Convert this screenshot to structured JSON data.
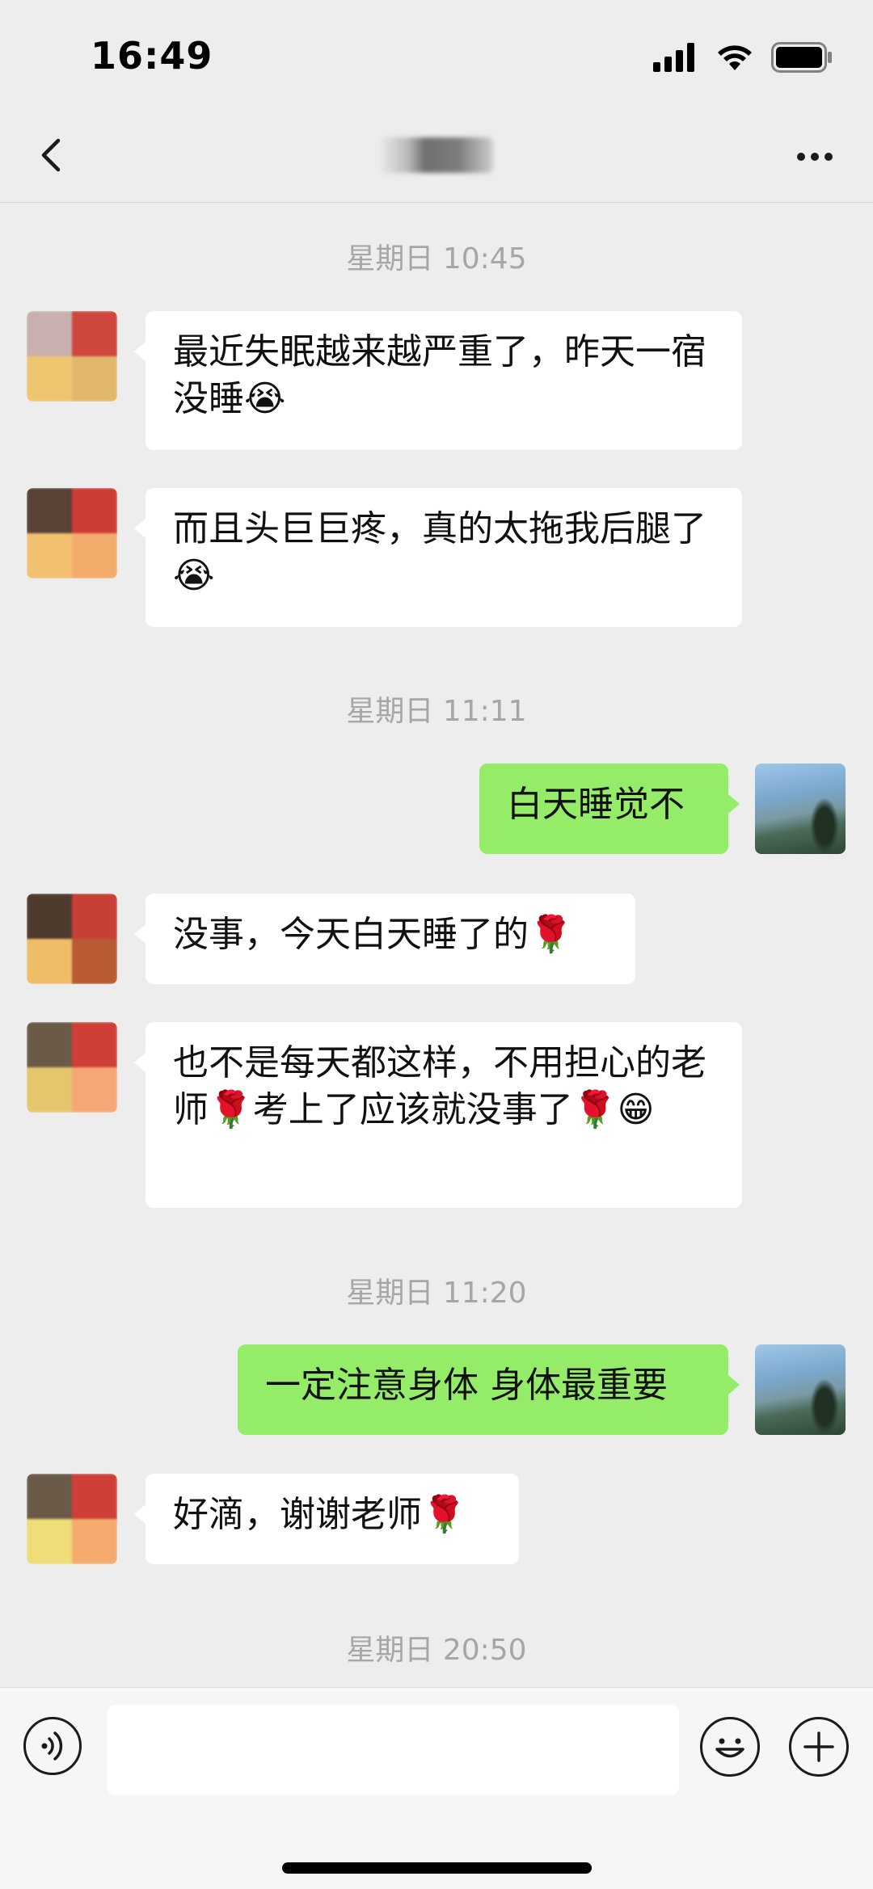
{
  "status_bar": {
    "time": "16:49"
  },
  "header": {
    "back_icon": "chevron-left-icon",
    "more_icon": "more-dots-icon"
  },
  "messages": [
    {
      "type": "time",
      "text": "星期日 10:45"
    },
    {
      "type": "received",
      "text": "最近失眠越来越严重了，昨天一宿没睡😭"
    },
    {
      "type": "received",
      "text": "而且头巨巨疼，真的太拖我后腿了😭"
    },
    {
      "type": "time",
      "text": "星期日 11:11"
    },
    {
      "type": "sent",
      "text": "白天睡觉不"
    },
    {
      "type": "received",
      "text": "没事，今天白天睡了的🌹"
    },
    {
      "type": "received",
      "text": "也不是每天都这样，不用担心的老师🌹考上了应该就没事了🌹😁"
    },
    {
      "type": "time",
      "text": "星期日 11:20"
    },
    {
      "type": "sent",
      "text": "一定注意身体 身体最重要"
    },
    {
      "type": "received",
      "text": "好滴，谢谢老师🌹"
    },
    {
      "type": "time",
      "text": "星期日 20:50"
    }
  ],
  "input_bar": {
    "placeholder": "",
    "voice_icon": "voice-icon",
    "emoji_icon": "emoji-icon",
    "plus_icon": "plus-icon"
  },
  "colors": {
    "background": "#ededed",
    "sent_bubble": "#95ec69",
    "received_bubble": "#ffffff",
    "timestamp": "#a6a6a6"
  }
}
